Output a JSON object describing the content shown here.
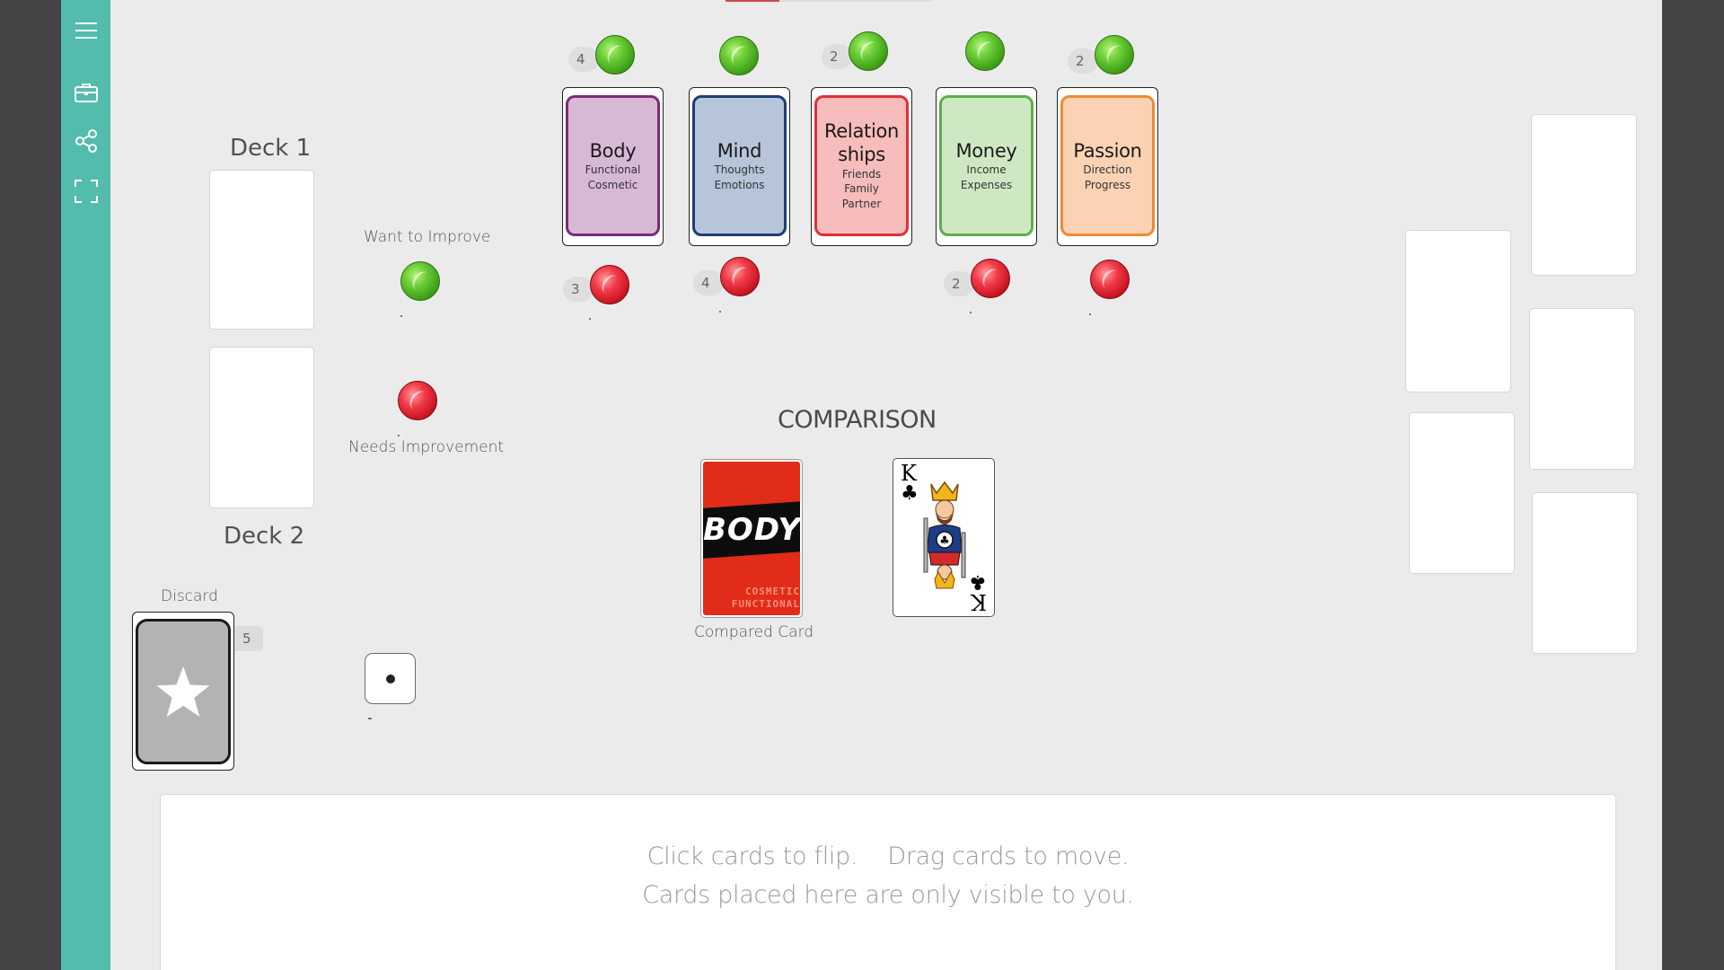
{
  "sidebar": {
    "icons": [
      "menu-icon",
      "briefcase-icon",
      "share-icon",
      "fullscreen-icon"
    ],
    "accent_color": "#54bcad"
  },
  "decks": {
    "deck1_label": "Deck 1",
    "deck2_label": "Deck 2"
  },
  "legend": {
    "want_label": "Want to Improve",
    "needs_label": "Needs Improvement"
  },
  "categories": [
    {
      "title_lines": [
        "Body"
      ],
      "subtitle_lines": [
        "Functional",
        "Cosmetic"
      ],
      "fill": "#d7b9d6",
      "border": "#7b2b78",
      "green_count": "4",
      "red_count": "3"
    },
    {
      "title_lines": [
        "Mind"
      ],
      "subtitle_lines": [
        "Thoughts",
        "Emotions"
      ],
      "fill": "#b6c5d9",
      "border": "#1f3d75",
      "green_count": "",
      "red_count": "4"
    },
    {
      "title_lines": [
        "Relation",
        "ships"
      ],
      "subtitle_lines": [
        "Friends",
        "Family",
        "Partner"
      ],
      "fill": "#f7bcbc",
      "border": "#e0303a",
      "green_count": "2",
      "red_count": ""
    },
    {
      "title_lines": [
        "Money"
      ],
      "subtitle_lines": [
        "Income",
        "Expenses"
      ],
      "fill": "#cfe8c4",
      "border": "#5eae4c",
      "green_count": "",
      "red_count": "2"
    },
    {
      "title_lines": [
        "Passion"
      ],
      "subtitle_lines": [
        "Direction",
        "Progress"
      ],
      "fill": "#fbd3b4",
      "border": "#ee8a3a",
      "green_count": "2",
      "red_count": ""
    }
  ],
  "comparison": {
    "title": "COMPARISON",
    "compared_label": "Compared Card",
    "body_card": {
      "word": "BODY",
      "line1": "COSMETIC",
      "line2": "FUNCTIONAL"
    },
    "king_card": {
      "rank": "K",
      "suit": "♣"
    }
  },
  "discard": {
    "label": "Discard",
    "count": "5"
  },
  "die": {
    "value": 1
  },
  "hand": {
    "line1": "Click cards to flip.    Drag cards to move.",
    "line2": "Cards placed here are only visible to you."
  }
}
